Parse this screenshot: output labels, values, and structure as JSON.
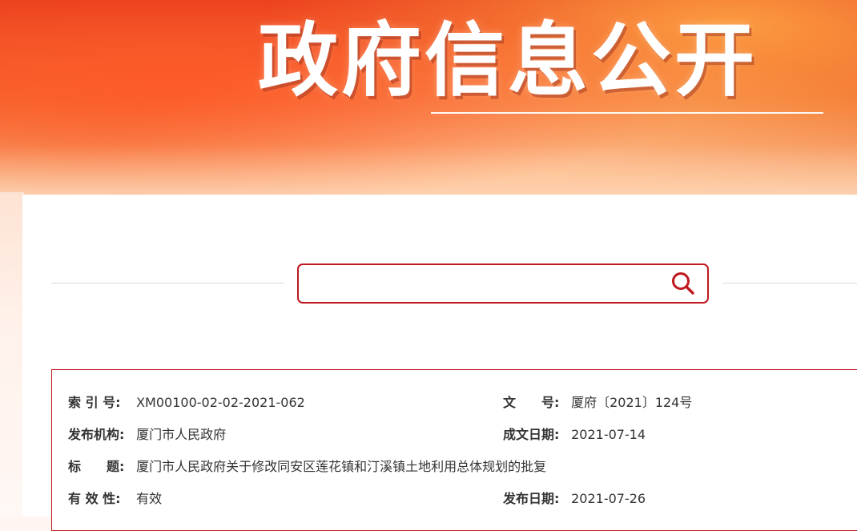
{
  "banner": {
    "title": "政府信息公开"
  },
  "search": {
    "placeholder": "",
    "value": ""
  },
  "info": {
    "index_label": "索 引 号:",
    "index_value": "XM00100-02-02-2021-062",
    "doc_no_label": "文　　号:",
    "doc_no_value": "厦府〔2021〕124号",
    "issuer_label": "发布机构:",
    "issuer_value": "厦门市人民政府",
    "written_date_label": "成文日期:",
    "written_date_value": "2021-07-14",
    "subject_label": "标　　题:",
    "subject_value": "厦门市人民政府关于修改同安区莲花镇和汀溪镇土地利用总体规划的批复",
    "validity_label": "有 效 性:",
    "validity_value": "有效",
    "publish_date_label": "发布日期:",
    "publish_date_value": "2021-07-26"
  },
  "colors": {
    "accent": "#c0181f",
    "banner_red": "#e63a1c",
    "banner_orange": "#f06a30"
  },
  "icons": {
    "search": "search-icon"
  }
}
